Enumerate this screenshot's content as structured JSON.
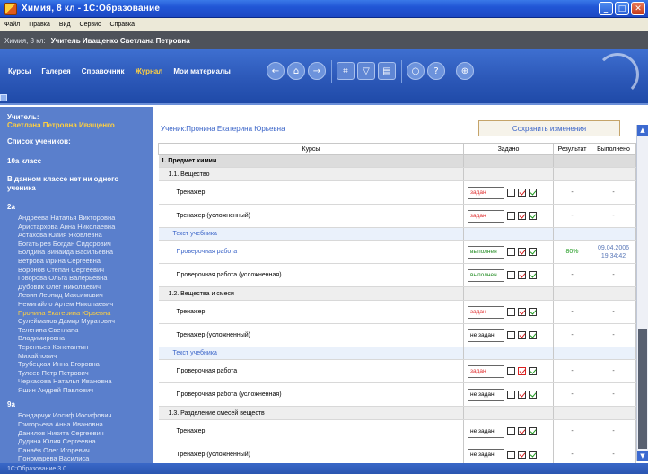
{
  "window": {
    "title": "Химия, 8 кл - 1С:Образование"
  },
  "menu": [
    "Файл",
    "Правка",
    "Вид",
    "Сервис",
    "Справка"
  ],
  "user_bar": {
    "prefix": "Химия, 8 кл:",
    "user": "Учитель Иващенко Светлана Петровна"
  },
  "toolbar": {
    "nav": [
      "Курсы",
      "Галерея",
      "Справочник",
      "Журнал",
      "Мои материалы"
    ],
    "active": "Журнал",
    "icons": [
      "back-arrow-icon",
      "home-icon",
      "forward-arrow-icon",
      "fullscreen-icon",
      "bookmark-icon",
      "print-icon",
      "search-icon",
      "help-icon",
      "zoom-icon"
    ]
  },
  "sidebar": {
    "teacher_label": "Учитель:",
    "teacher_name": "Светлана Петровна Иващенко",
    "students_label": "Список учеников:",
    "class_10a": "10а класс",
    "class_10a_note": "В данном классе нет ни одного ученика",
    "class_2a": "2а",
    "students_2a": [
      "Андреева Наталья Викторовна",
      "Аристархова Анна Николаевна",
      "Астахова Юлия Яковлевна",
      "Богатырев Богдан Сидорович",
      "Болдина Зинаида Васильевна",
      "Ветрова Ирина Сергеевна",
      "Воронов Степан Сергеевич",
      "Говорова Ольга Валерьевна",
      "Дубовик Олег Николаевич",
      "Левин Леонид Максимович",
      "Немигайло Артем Николаевич",
      "Пронина Екатерина Юрьевна",
      "Сулейманов Дамир Муратович",
      "Телегина Светлана",
      "Владимировна",
      "Терентьев Константин",
      "Михайлович",
      "Трубецкая Инна Егоровна",
      "Тулеев Петр Петрович",
      "Черкасова Наталья Ивановна",
      "Яшин Андрей Павлович"
    ],
    "selected_student": "Пронина Екатерина Юрьевна",
    "class_9a": "9а",
    "students_9a": [
      "Бондарчук Иосиф Иосифович",
      "Григорьева Анна Ивановна",
      "Данилов Никита Сергеевич",
      "Дудина Юлия Сергеевна",
      "Панаёв Олег Игоревич",
      "Пономарева Василиса"
    ]
  },
  "main": {
    "student_line": "Ученик:Пронина Екатерина Юрьевна",
    "save_button": "Сохранить изменения",
    "columns": {
      "course": "Курсы",
      "set": "Задано",
      "result": "Результат",
      "done": "Выполнено"
    },
    "rows": [
      {
        "kind": "sec",
        "name": "1. Предмет химии"
      },
      {
        "kind": "sub",
        "name": "1.1. Вещество"
      },
      {
        "kind": "item",
        "name": "Тренажер",
        "status": "задан",
        "color": "red",
        "cb": [
          "",
          "r",
          "g"
        ],
        "result": "-",
        "done": "-"
      },
      {
        "kind": "item",
        "name": "Тренажер (усложненный)",
        "status": "задан",
        "color": "red",
        "cb": [
          "",
          "r",
          "g"
        ],
        "result": "-",
        "done": "-"
      },
      {
        "kind": "link",
        "name": "Текст учебника"
      },
      {
        "kind": "item",
        "blue": true,
        "name": "Проверочная работа",
        "status": "выполнен",
        "color": "green",
        "cb": [
          "",
          "r",
          "g"
        ],
        "result": "80%",
        "ok": true,
        "done": "09.04.2006 19:34:42"
      },
      {
        "kind": "item",
        "name": "Проверочная работа (усложненная)",
        "status": "выполнен",
        "color": "green",
        "cb": [
          "",
          "r",
          "g"
        ],
        "result": "-",
        "done": "-"
      },
      {
        "kind": "sub",
        "name": "1.2. Вещества и смеси"
      },
      {
        "kind": "item",
        "name": "Тренажер",
        "status": "задан",
        "color": "red",
        "cb": [
          "",
          "r",
          "g"
        ],
        "result": "-",
        "done": "-"
      },
      {
        "kind": "item",
        "name": "Тренажер (усложненный)",
        "status": "не задан",
        "color": "black",
        "cb": [
          "",
          "r",
          "g"
        ],
        "result": "-",
        "done": "-"
      },
      {
        "kind": "link",
        "name": "Текст учебника"
      },
      {
        "kind": "item",
        "name": "Проверочная работа",
        "status": "задан",
        "color": "red",
        "cb": [
          "",
          "rr",
          "g"
        ],
        "result": "-",
        "done": "-"
      },
      {
        "kind": "item",
        "name": "Проверочная работа (усложненная)",
        "status": "не задан",
        "color": "black",
        "cb": [
          "",
          "r",
          "g"
        ],
        "result": "-",
        "done": "-"
      },
      {
        "kind": "sub",
        "name": "1.3. Разделение смесей веществ"
      },
      {
        "kind": "item",
        "name": "Тренажер",
        "status": "не задан",
        "color": "black",
        "cb": [
          "",
          "r",
          "g"
        ],
        "result": "-",
        "done": "-"
      },
      {
        "kind": "item",
        "name": "Тренажер (усложненный)",
        "status": "не задан",
        "color": "black",
        "cb": [
          "",
          "r",
          "g"
        ],
        "result": "-",
        "done": "-"
      },
      {
        "kind": "link",
        "name": "Текст учебника"
      }
    ]
  },
  "status_bar": "1С:Образование 3.0",
  "colors": {
    "accent": "#2c58b8",
    "active_nav": "#ffd040",
    "link": "#3a64c8",
    "red": "#e03030",
    "green": "#1e8a1e"
  }
}
